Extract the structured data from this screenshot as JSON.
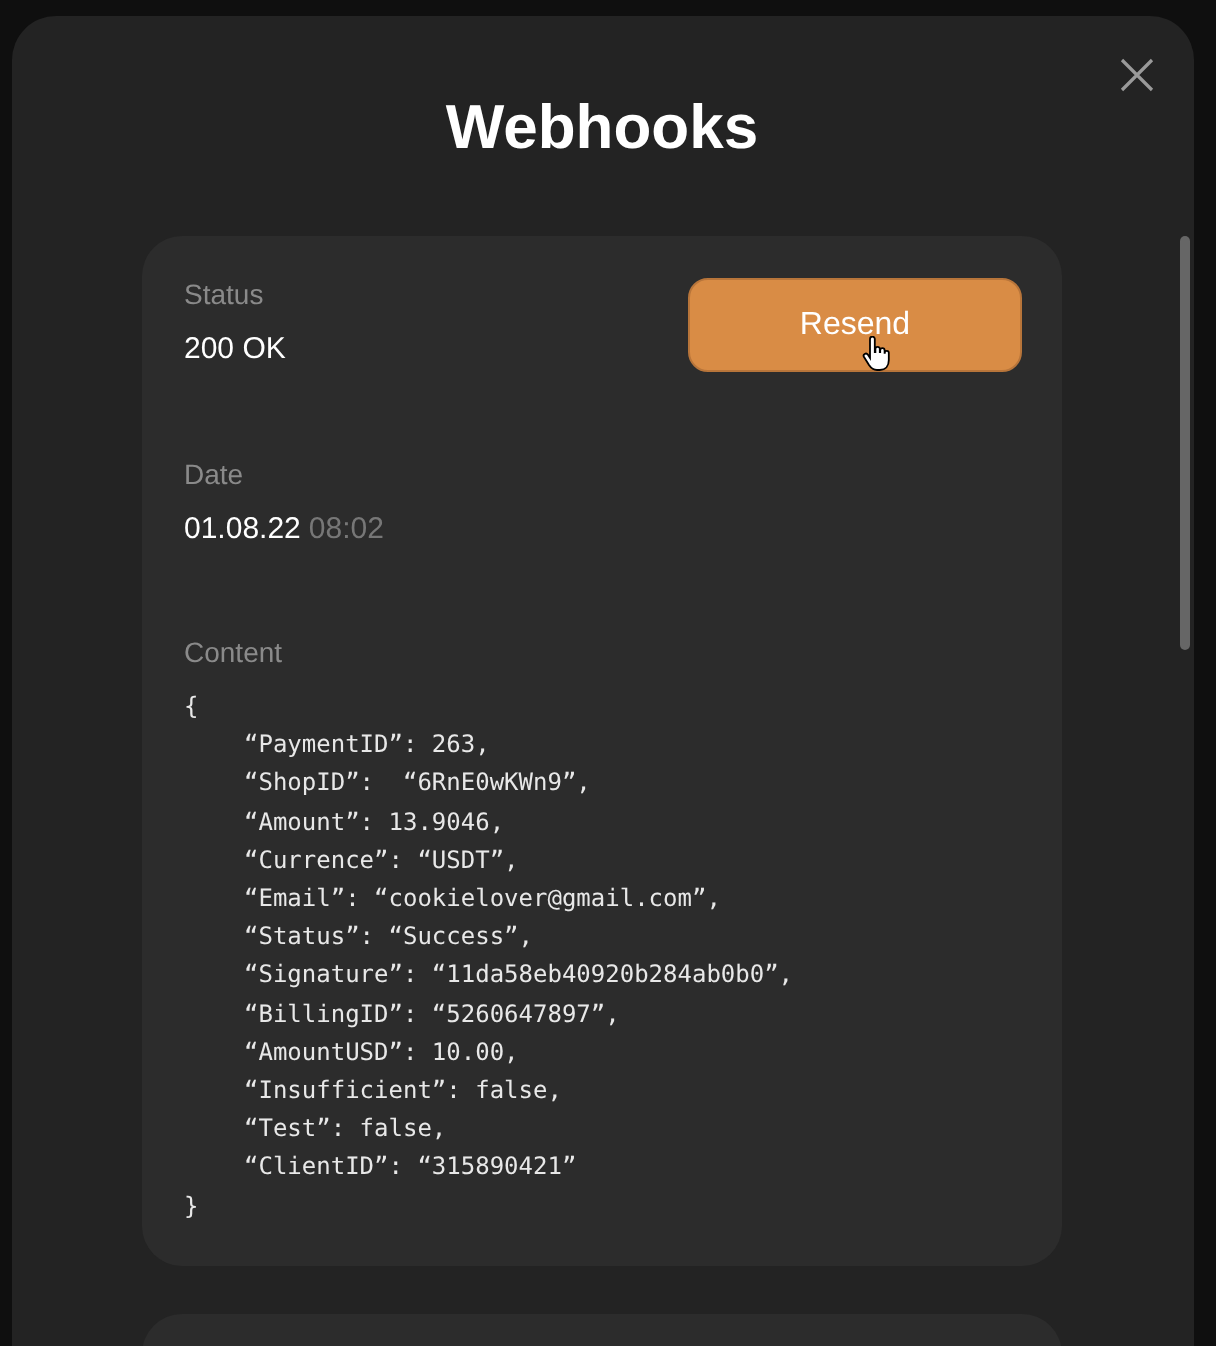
{
  "dialog": {
    "title": "Webhooks"
  },
  "webhook": {
    "status": {
      "label": "Status",
      "value": "200 OK"
    },
    "action": {
      "label": "Resend"
    },
    "date": {
      "label": "Date",
      "value": "01.08.22",
      "time": "08:02"
    },
    "content": {
      "label": "Content",
      "open": "{",
      "close": "}",
      "lines": [
        "“PaymentID”: 263,",
        "“ShopID”:  “6RnE0wKWn9”,",
        "“Amount”: 13.9046,",
        "“Currence”: “USDT”,",
        "“Email”: “cookielover@gmail.com”,",
        "“Status”: “Success”,",
        "“Signature”: “11da58eb40920b284ab0b0”,",
        "“BillingID”: “5260647897”,",
        "“AmountUSD”: 10.00,",
        "“Insufficient”: false,",
        "“Test”: false,",
        "“ClientID”: “315890421”"
      ]
    }
  }
}
